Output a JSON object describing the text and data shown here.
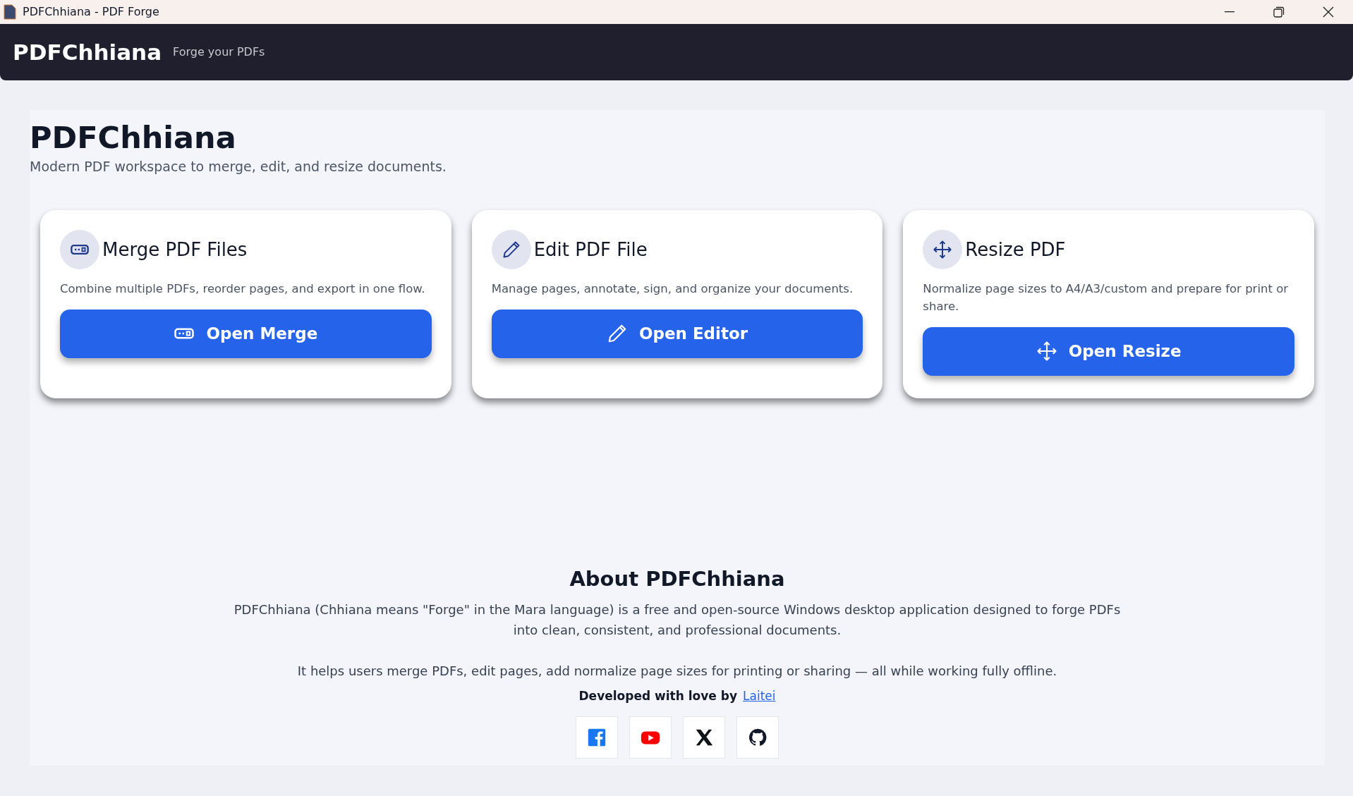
{
  "window": {
    "title": "PDFChhiana - PDF Forge"
  },
  "navbar": {
    "brand": "PDFChhiana",
    "tagline": "Forge your PDFs"
  },
  "hero": {
    "title": "PDFChhiana",
    "subtitle": "Modern PDF workspace to merge, edit, and resize documents."
  },
  "cards": [
    {
      "title": "Merge PDF Files",
      "description": "Combine multiple PDFs, reorder pages, and export in one flow.",
      "button": "Open Merge"
    },
    {
      "title": "Edit PDF File",
      "description": "Manage pages, annotate, sign, and organize your documents.",
      "button": "Open Editor"
    },
    {
      "title": "Resize PDF",
      "description": "Normalize page sizes to A4/A3/custom and prepare for print or share.",
      "button": "Open Resize"
    }
  ],
  "about": {
    "title": "About PDFChhiana",
    "paragraphs": [
      "PDFChhiana (Chhiana means \"Forge\" in the Mara language) is a free and open-source Windows desktop application designed to forge PDFs into clean, consistent, and professional documents.",
      "It helps users merge PDFs, edit pages, add normalize page sizes for printing or sharing — all while working fully offline."
    ],
    "credit": "Developed with love by",
    "author": "Laitei"
  }
}
